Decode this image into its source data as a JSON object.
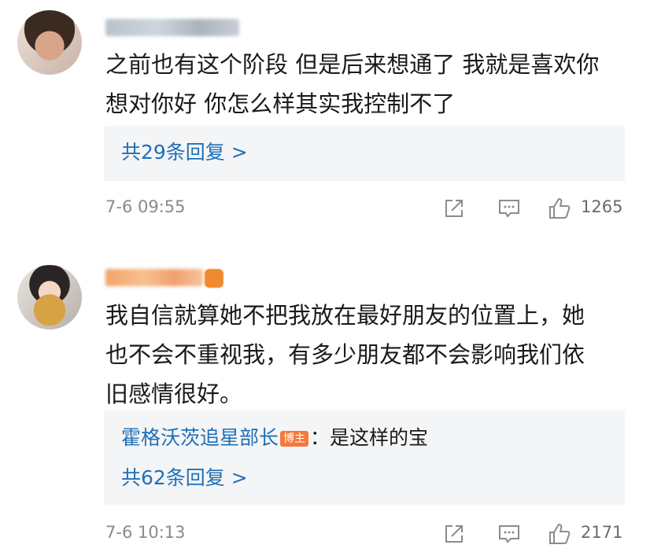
{
  "comments": [
    {
      "text_lines": [
        "之前也有这个阶段 但是后来想通了 我就是喜欢你",
        "想对你好 你怎么样其实我控制不了"
      ],
      "reply_count_label": "共29条回复 >",
      "timestamp": "7-6 09:55",
      "like_count": "1265",
      "icons": [
        "share-icon",
        "comment-icon",
        "like-icon"
      ]
    },
    {
      "text_lines": [
        "我自信就算她不把我放在最好朋友的位置上，她",
        "也不会不重视我，有多少朋友都不会影响我们依",
        "旧感情很好。"
      ],
      "reply_author": "霍格沃茨追星部长",
      "reply_author_badge": "博主",
      "reply_text": "：是这样的宝",
      "reply_count_label": "共62条回复 >",
      "timestamp": "7-6 10:13",
      "like_count": "2171",
      "icons": [
        "share-icon",
        "comment-icon",
        "like-icon"
      ]
    }
  ],
  "colors": {
    "link_blue": "#1f70b8",
    "reply_background": "#f4f5f6",
    "meta_gray": "#8a8a8a",
    "badge_orange": "#f5793a"
  }
}
